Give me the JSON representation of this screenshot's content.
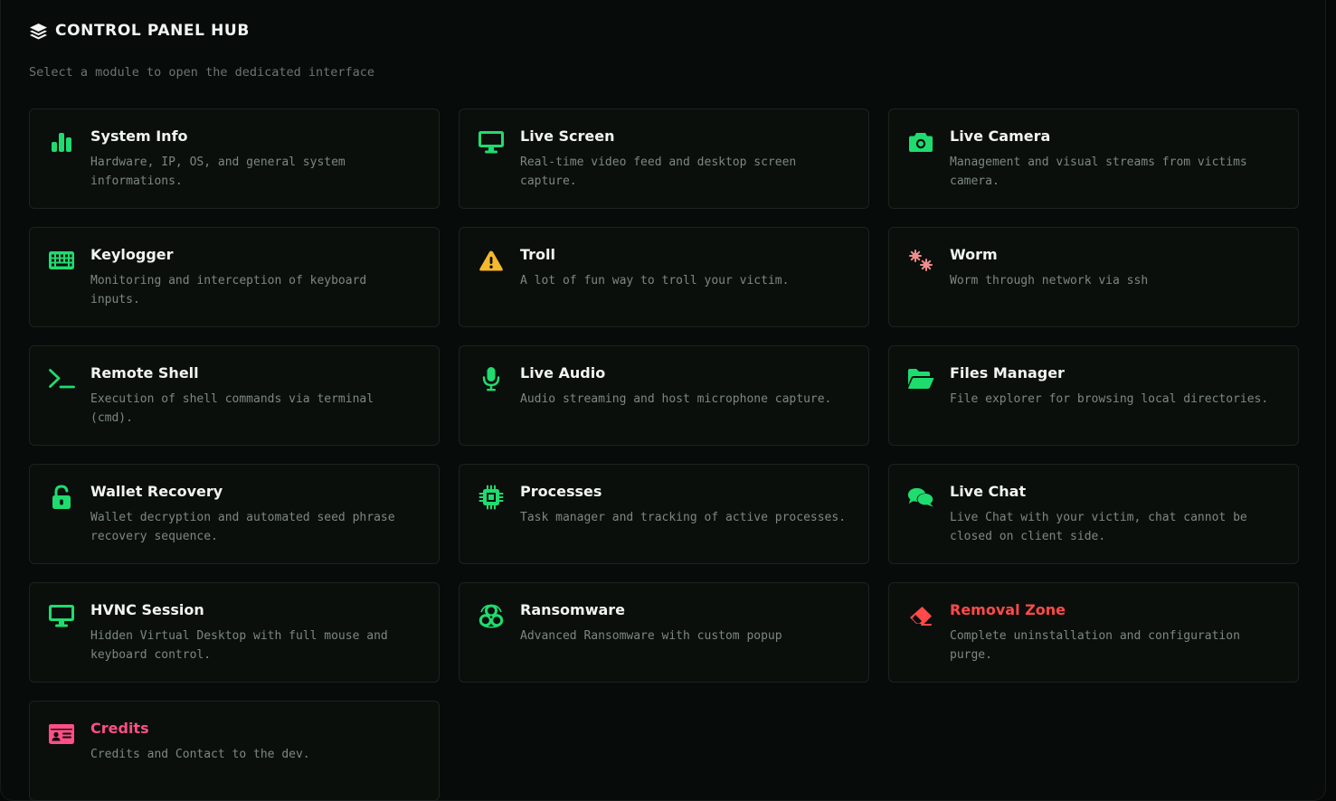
{
  "header": {
    "title": "CONTROL PANEL HUB",
    "icon": "layers-icon",
    "subtitle": "Select a module to open the dedicated interface"
  },
  "colors": {
    "accent": "#1fdc6f",
    "warning": "#f5b82e",
    "danger": "#ff4a4a",
    "credits": "#ff4e88",
    "worm": "#f08c8c"
  },
  "modules": [
    {
      "title": "System Info",
      "description": "Hardware, IP, OS, and general system informations.",
      "icon": "bar-chart-icon"
    },
    {
      "title": "Live Screen",
      "description": "Real-time video feed and desktop screen capture.",
      "icon": "monitor-icon"
    },
    {
      "title": "Live Camera",
      "description": "Management and visual streams from victims camera.",
      "icon": "camera-icon"
    },
    {
      "title": "Keylogger",
      "description": "Monitoring and interception of keyboard inputs.",
      "icon": "keyboard-icon"
    },
    {
      "title": "Troll",
      "description": "A lot of fun way to troll your victim.",
      "icon": "warning-icon"
    },
    {
      "title": "Worm",
      "description": "Worm through network via ssh",
      "icon": "virus-icon"
    },
    {
      "title": "Remote Shell",
      "description": "Execution of shell commands via terminal (cmd).",
      "icon": "terminal-icon"
    },
    {
      "title": "Live Audio",
      "description": "Audio streaming and host microphone capture.",
      "icon": "microphone-icon"
    },
    {
      "title": "Files Manager",
      "description": "File explorer for browsing local directories.",
      "icon": "folder-open-icon"
    },
    {
      "title": "Wallet Recovery",
      "description": "Wallet decryption and automated seed phrase recovery sequence.",
      "icon": "unlock-icon"
    },
    {
      "title": "Processes",
      "description": "Task manager and tracking of active processes.",
      "icon": "cpu-icon"
    },
    {
      "title": "Live Chat",
      "description": "Live Chat with your victim, chat cannot be closed on client side.",
      "icon": "chat-bubbles-icon"
    },
    {
      "title": "HVNC Session",
      "description": "Hidden Virtual Desktop with full mouse and keyboard control.",
      "icon": "monitor-icon"
    },
    {
      "title": "Ransomware",
      "description": "Advanced Ransomware with custom popup",
      "icon": "biohazard-icon"
    },
    {
      "title": "Removal Zone",
      "description": "Complete uninstallation and configuration purge.",
      "icon": "eraser-icon"
    },
    {
      "title": "Credits",
      "description": "Credits and Contact to the dev.",
      "icon": "id-card-icon"
    }
  ]
}
